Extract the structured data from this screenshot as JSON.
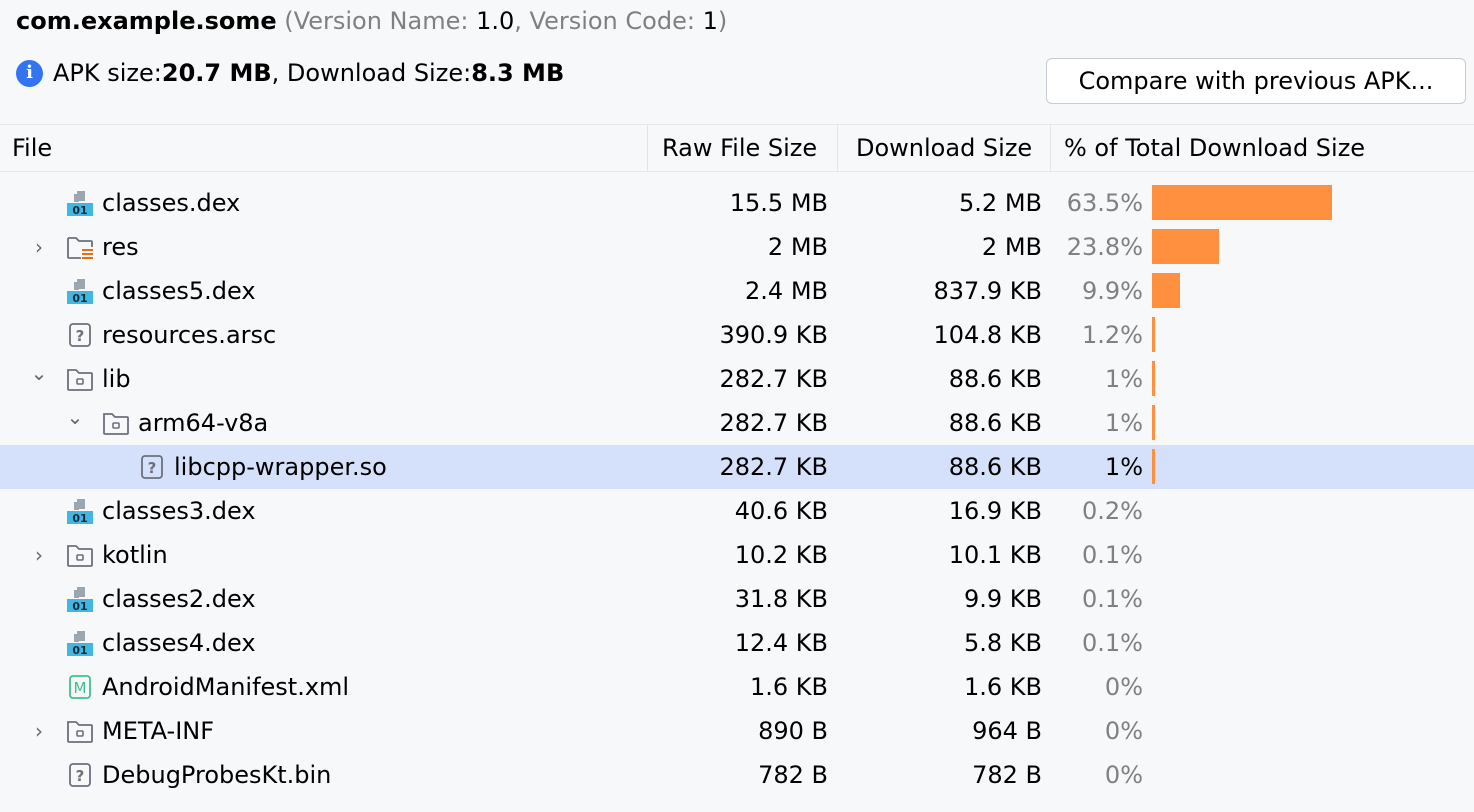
{
  "header": {
    "package": "com.example.some",
    "open_paren": " (",
    "version_name_label": "Version Name: ",
    "version_name": "1.0",
    "comma": ", ",
    "version_code_label": "Version Code: ",
    "version_code": "1",
    "close_paren": ")"
  },
  "summary": {
    "apk_size_label": "APK size: ",
    "apk_size": "20.7 MB",
    "download_size_label": ", Download Size: ",
    "download_size": "8.3 MB"
  },
  "compare_button": "Compare with previous APK...",
  "columns": [
    "File",
    "Raw File Size",
    "Download Size",
    "% of Total Download Size"
  ],
  "colors": {
    "bar": "#ff9040",
    "selection": "#d5e1fa",
    "muted": "#808080"
  },
  "rows": [
    {
      "name": "classes.dex",
      "icon": "dex-file-icon",
      "indent": 0,
      "chevron": "",
      "raw": "15.5 MB",
      "download": "5.2 MB",
      "percent": "63.5%",
      "fraction": 0.635
    },
    {
      "name": "res",
      "icon": "resource-folder-icon",
      "indent": 0,
      "chevron": "›",
      "raw": "2 MB",
      "download": "2 MB",
      "percent": "23.8%",
      "fraction": 0.238
    },
    {
      "name": "classes5.dex",
      "icon": "dex-file-icon",
      "indent": 0,
      "chevron": "",
      "raw": "2.4 MB",
      "download": "837.9 KB",
      "percent": "9.9%",
      "fraction": 0.099
    },
    {
      "name": "resources.arsc",
      "icon": "unknown-file-icon",
      "indent": 0,
      "chevron": "",
      "raw": "390.9 KB",
      "download": "104.8 KB",
      "percent": "1.2%",
      "fraction": 0.012
    },
    {
      "name": "lib",
      "icon": "folder-icon",
      "indent": 0,
      "chevron": "⌄",
      "raw": "282.7 KB",
      "download": "88.6 KB",
      "percent": "1%",
      "fraction": 0.01
    },
    {
      "name": "arm64-v8a",
      "icon": "folder-icon",
      "indent": 1,
      "chevron": "⌄",
      "raw": "282.7 KB",
      "download": "88.6 KB",
      "percent": "1%",
      "fraction": 0.01
    },
    {
      "name": "libcpp-wrapper.so",
      "icon": "unknown-file-icon",
      "indent": 2,
      "chevron": "",
      "raw": "282.7 KB",
      "download": "88.6 KB",
      "percent": "1%",
      "fraction": 0.01,
      "selected": true
    },
    {
      "name": "classes3.dex",
      "icon": "dex-file-icon",
      "indent": 0,
      "chevron": "",
      "raw": "40.6 KB",
      "download": "16.9 KB",
      "percent": "0.2%",
      "fraction": 0.002
    },
    {
      "name": "kotlin",
      "icon": "folder-icon",
      "indent": 0,
      "chevron": "›",
      "raw": "10.2 KB",
      "download": "10.1 KB",
      "percent": "0.1%",
      "fraction": 0.001
    },
    {
      "name": "classes2.dex",
      "icon": "dex-file-icon",
      "indent": 0,
      "chevron": "",
      "raw": "31.8 KB",
      "download": "9.9 KB",
      "percent": "0.1%",
      "fraction": 0.001
    },
    {
      "name": "classes4.dex",
      "icon": "dex-file-icon",
      "indent": 0,
      "chevron": "",
      "raw": "12.4 KB",
      "download": "5.8 KB",
      "percent": "0.1%",
      "fraction": 0.001
    },
    {
      "name": "AndroidManifest.xml",
      "icon": "manifest-file-icon",
      "indent": 0,
      "chevron": "",
      "raw": "1.6 KB",
      "download": "1.6 KB",
      "percent": "0%",
      "fraction": 0
    },
    {
      "name": "META-INF",
      "icon": "folder-icon",
      "indent": 0,
      "chevron": "›",
      "raw": "890 B",
      "download": "964 B",
      "percent": "0%",
      "fraction": 0
    },
    {
      "name": "DebugProbesKt.bin",
      "icon": "unknown-file-icon",
      "indent": 0,
      "chevron": "",
      "raw": "782 B",
      "download": "782 B",
      "percent": "0%",
      "fraction": 0
    }
  ]
}
